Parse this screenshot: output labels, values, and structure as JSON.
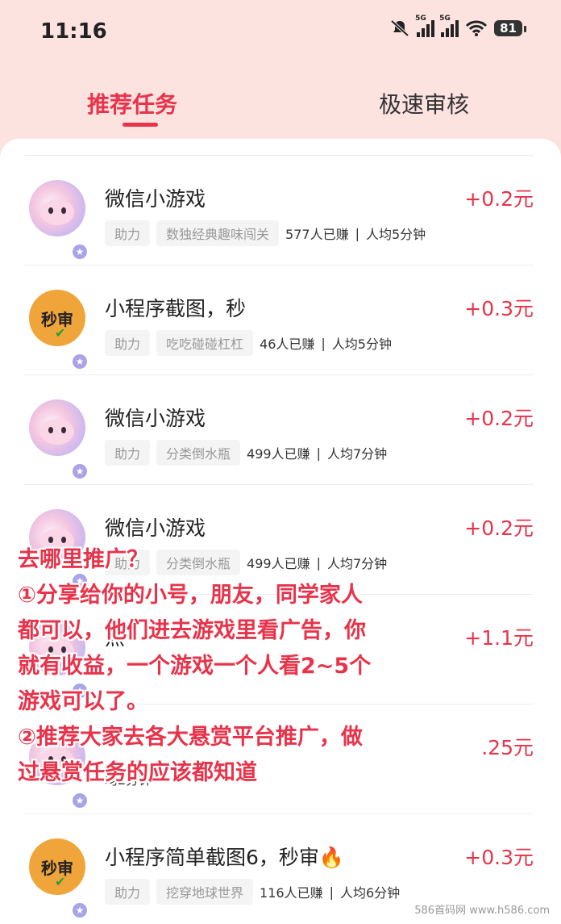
{
  "status_bar": {
    "time": "11:16",
    "battery": "81",
    "signal1_label": "5G",
    "signal2_label": "5G"
  },
  "tabs": [
    {
      "label": "推荐任务"
    },
    {
      "label": "极速审核"
    }
  ],
  "tasks": [
    {
      "avatar": "game",
      "title": "微信小游戏",
      "reward": "+0.2元",
      "tag1": "助力",
      "tag2": "数独经典趣味闯关",
      "earned": "577人已赚",
      "avg": "人均5分钟"
    },
    {
      "avatar": "miao",
      "avatar_text": "秒审",
      "title": "小程序截图，秒",
      "reward": "+0.3元",
      "tag1": "助力",
      "tag2": "吃吃碰碰杠杠",
      "earned": "46人已赚",
      "avg": "人均5分钟"
    },
    {
      "avatar": "game",
      "title": "微信小游戏",
      "reward": "+0.2元",
      "tag1": "助力",
      "tag2": "分类倒水瓶",
      "earned": "499人已赚",
      "avg": "人均7分钟"
    },
    {
      "avatar": "game",
      "title": "微信小游戏",
      "reward": "+0.2元",
      "tag1": "助力",
      "tag2": "分类倒水瓶",
      "earned": "499人已赚",
      "avg": "人均7分钟"
    },
    {
      "avatar": "game",
      "title": "点",
      "reward": "+1.1元",
      "tag1": "",
      "tag2": "",
      "earned": "",
      "avg": ""
    },
    {
      "avatar": "game",
      "title": "",
      "reward": ".25元",
      "tag1": "",
      "tag2": "",
      "earned": "",
      "avg": "均2分钟"
    },
    {
      "avatar": "miao",
      "avatar_text": "秒审",
      "title": "小程序简单截图6，秒审🔥",
      "reward": "+0.3元",
      "tag1": "助力",
      "tag2": "挖穿地球世界",
      "earned": "116人已赚",
      "avg": "人均6分钟"
    }
  ],
  "overlay_lines": [
    "去哪里推广？",
    "①分享给你的小号，朋友，同学家人",
    "都可以，他们进去游戏里看广告，你",
    "就有收益，一个游戏一个人看2~5个",
    "游戏可以了。",
    "②推荐大家去各大悬赏平台推广，做",
    "过悬赏任务的应该都知道"
  ],
  "watermark": "586首码网 www.h586.com",
  "colors": {
    "accent": "#e8334a",
    "header_bg": "#fde3e0"
  }
}
